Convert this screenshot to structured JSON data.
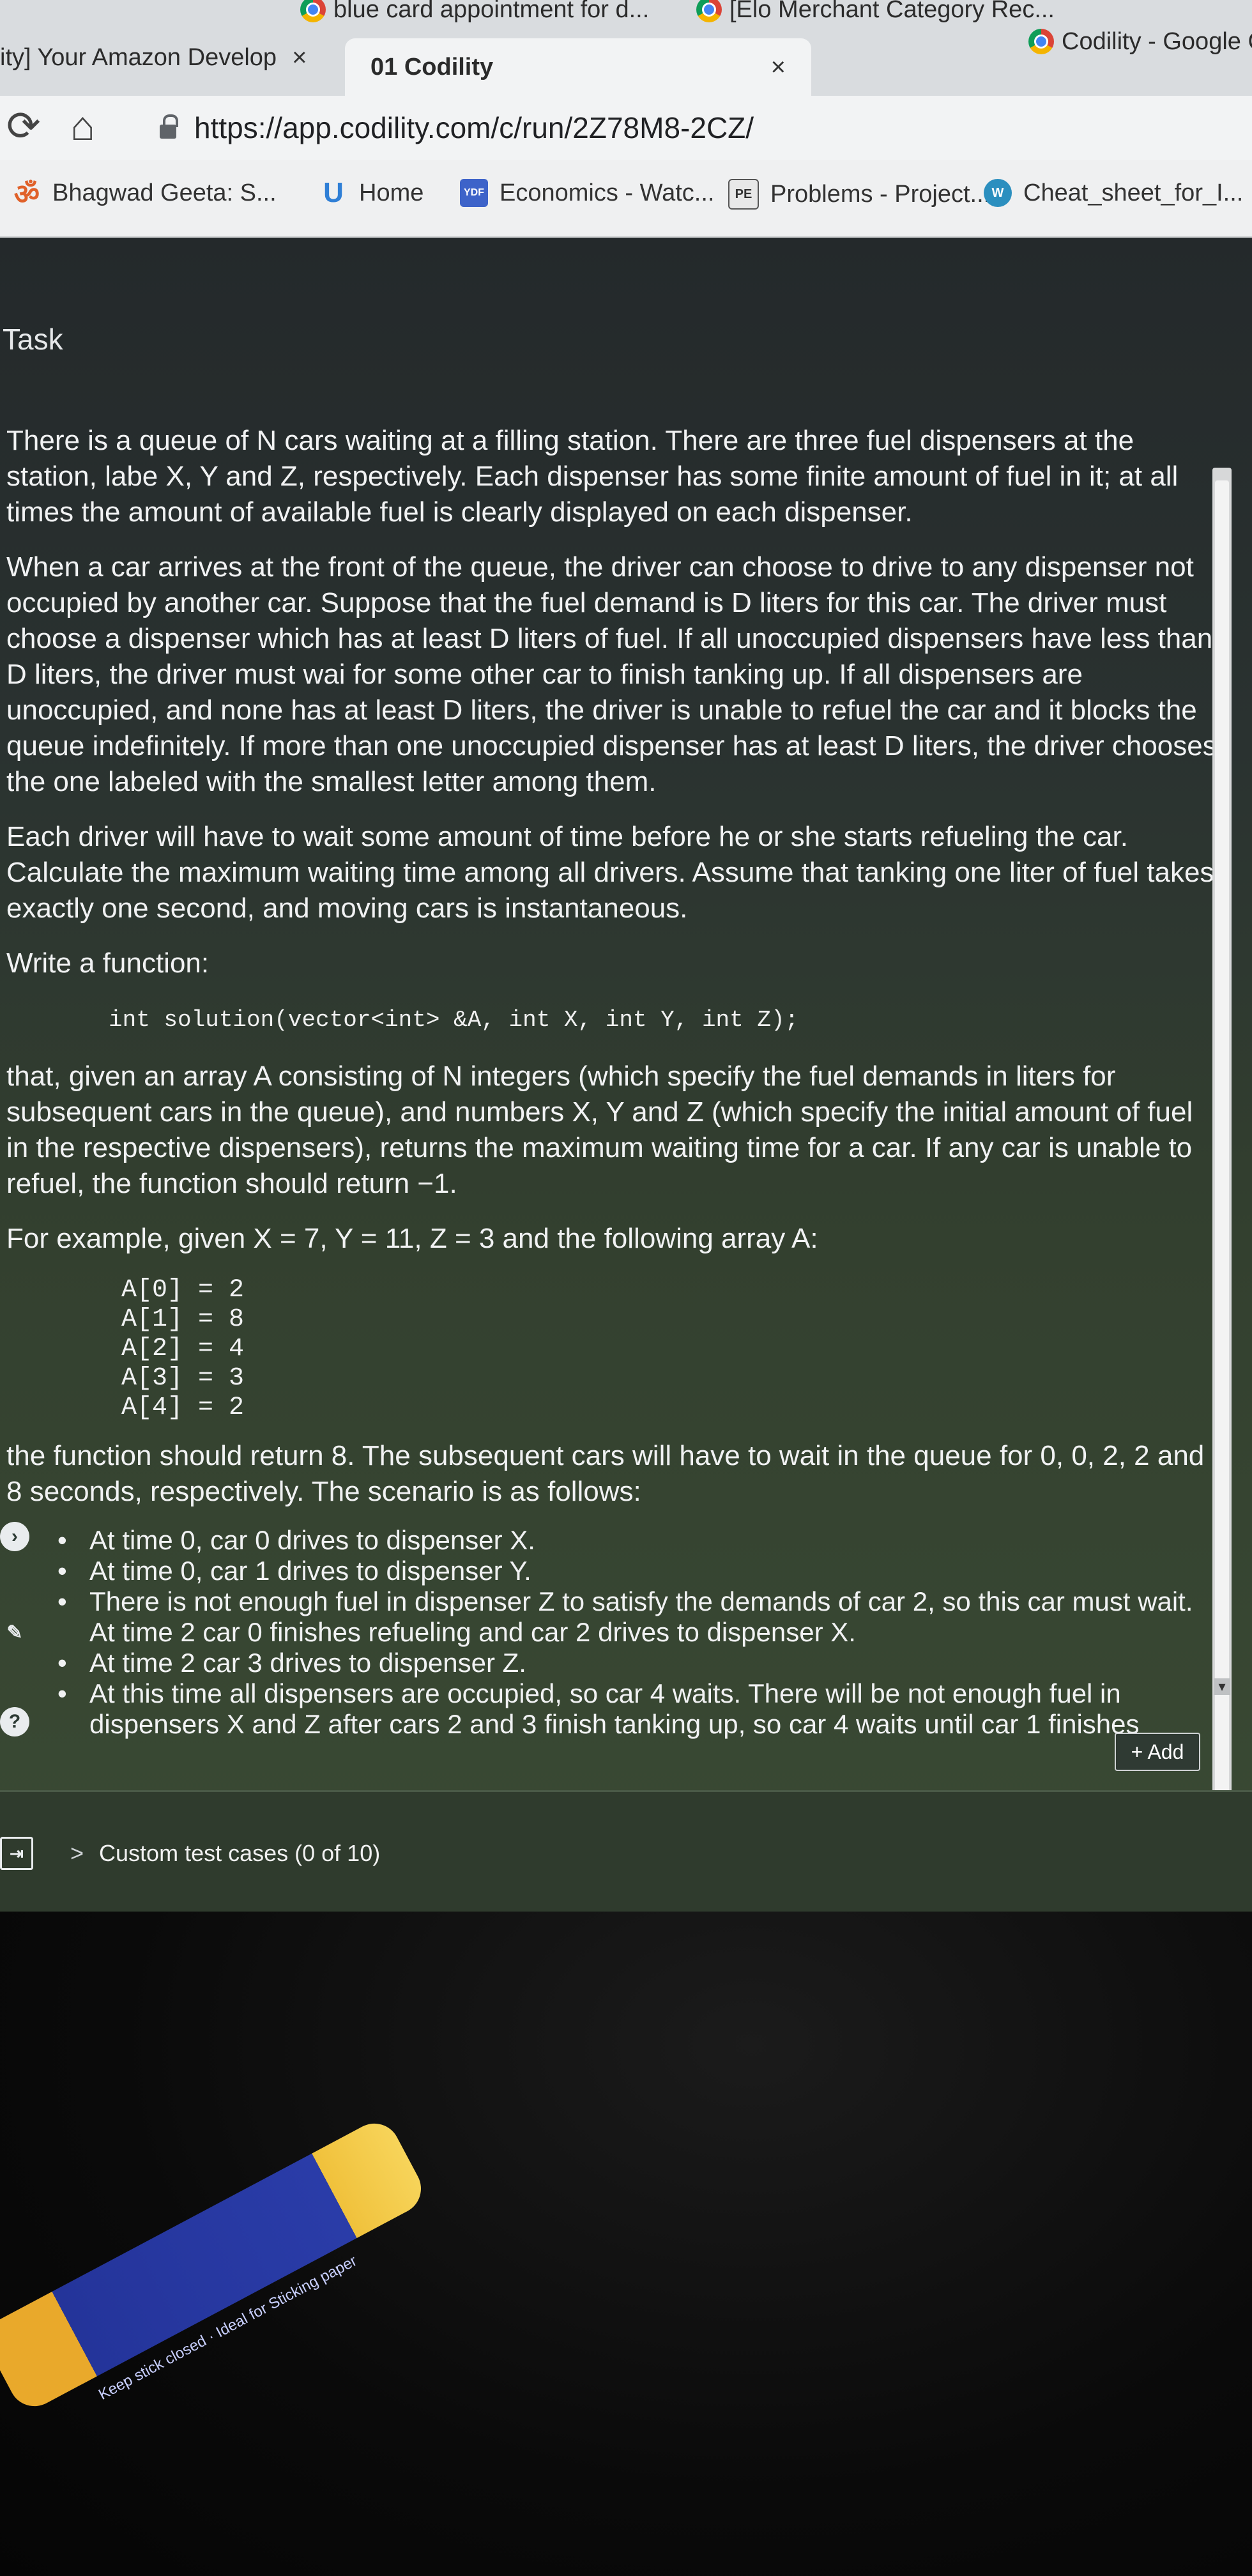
{
  "tabs": [
    {
      "title": "ity] Your Amazon Develop",
      "close": "×"
    },
    {
      "title": "01 Codility",
      "close": "×"
    }
  ],
  "top_tabs_partial": [
    {
      "title": "blue card appointment for d..."
    },
    {
      "title": "[Elo Merchant Category Rec..."
    },
    {
      "title": "Codility - Google Chro"
    }
  ],
  "new_tab": "+",
  "nav": {
    "reload": "⟳",
    "home": "⌂"
  },
  "address": "https://app.codility.com/c/run/2Z78M8-2CZ/",
  "bookmarks": [
    {
      "label": "Bhagwad Geeta: S...",
      "icon": "om-icon",
      "glyph": "ॐ",
      "color": "#e0612a"
    },
    {
      "label": "Home",
      "icon": "udacity-icon",
      "glyph": "U",
      "color": "#2f7fd6"
    },
    {
      "label": "Economics - Watc...",
      "icon": "ydf-icon",
      "glyph": "YDF",
      "color": "#3d63c9"
    },
    {
      "label": "Problems - Project...",
      "icon": "pe-icon",
      "glyph": "PE",
      "color": "#7a7a7a"
    },
    {
      "label": "Cheat_sheet_for_I...",
      "icon": "wordpress-icon",
      "glyph": "W",
      "color": "#2b8fbf"
    }
  ],
  "task": {
    "title": "Task",
    "p1": "There is a queue of N cars waiting at a filling station. There are three fuel dispensers at the station, labe X, Y and Z, respectively. Each dispenser has some finite amount of fuel in it; at all times the amount of available fuel is clearly displayed on each dispenser.",
    "p2": "When a car arrives at the front of the queue, the driver can choose to drive to any dispenser not occupied by another car. Suppose that the fuel demand is D liters for this car. The driver must choose a dispenser which has at least D liters of fuel. If all unoccupied dispensers have less than D liters, the driver must wai for some other car to finish tanking up. If all dispensers are unoccupied, and none has at least D liters, the driver is unable to refuel the car and it blocks the queue indefinitely. If more than one unoccupied dispenser has at least D liters, the driver chooses the one labeled with the smallest letter among them.",
    "p3": "Each driver will have to wait some amount of time before he or she starts refueling the car. Calculate the maximum waiting time among all drivers. Assume that tanking one liter of fuel takes exactly one second, and moving cars is instantaneous.",
    "p4": "Write a function:",
    "code": "int solution(vector<int> &A, int X, int Y, int Z);",
    "p5": "that, given an array A consisting of N integers (which specify the fuel demands in liters for subsequent cars in the queue), and numbers X, Y and Z (which specify the initial amount of fuel in the respective dispensers), returns the maximum waiting time for a car. If any car is unable to refuel, the function should return −1.",
    "p6": "For example, given X = 7, Y = 11, Z = 3 and the following array A:",
    "array": [
      "A[0] = 2",
      "A[1] = 8",
      "A[2] = 4",
      "A[3] = 3",
      "A[4] = 2"
    ],
    "p7": "the function should return 8. The subsequent cars will have to wait in the queue for 0, 0, 2, 2 and 8 seconds, respectively. The scenario is as follows:",
    "bullets": [
      "At time 0, car 0 drives to dispenser X.",
      "At time 0, car 1 drives to dispenser Y.",
      "There is not enough fuel in dispenser Z to satisfy the demands of car 2, so this car must wait. At time 2 car 0 finishes refueling and car 2 drives to dispenser X.",
      "At time 2 car 3 drives to dispenser Z.",
      "At this time all dispensers are occupied, so car 4 waits. There will be not enough fuel in dispensers X and Z after cars 2 and 3 finish tanking up, so car 4 waits until car 1 finishes"
    ]
  },
  "add_button": "+ Add",
  "custom_tests": "Custom test cases (0 of 10)",
  "custom_chevron": ">",
  "left_icons": [
    "?"
  ],
  "glue_stick": {
    "text": "Keep stick closed · Ideal for Sticking paper"
  },
  "colors": {
    "page_bg": "#2a3230",
    "tabbar": "#d9dcdf",
    "text": "#f1f2f3"
  }
}
